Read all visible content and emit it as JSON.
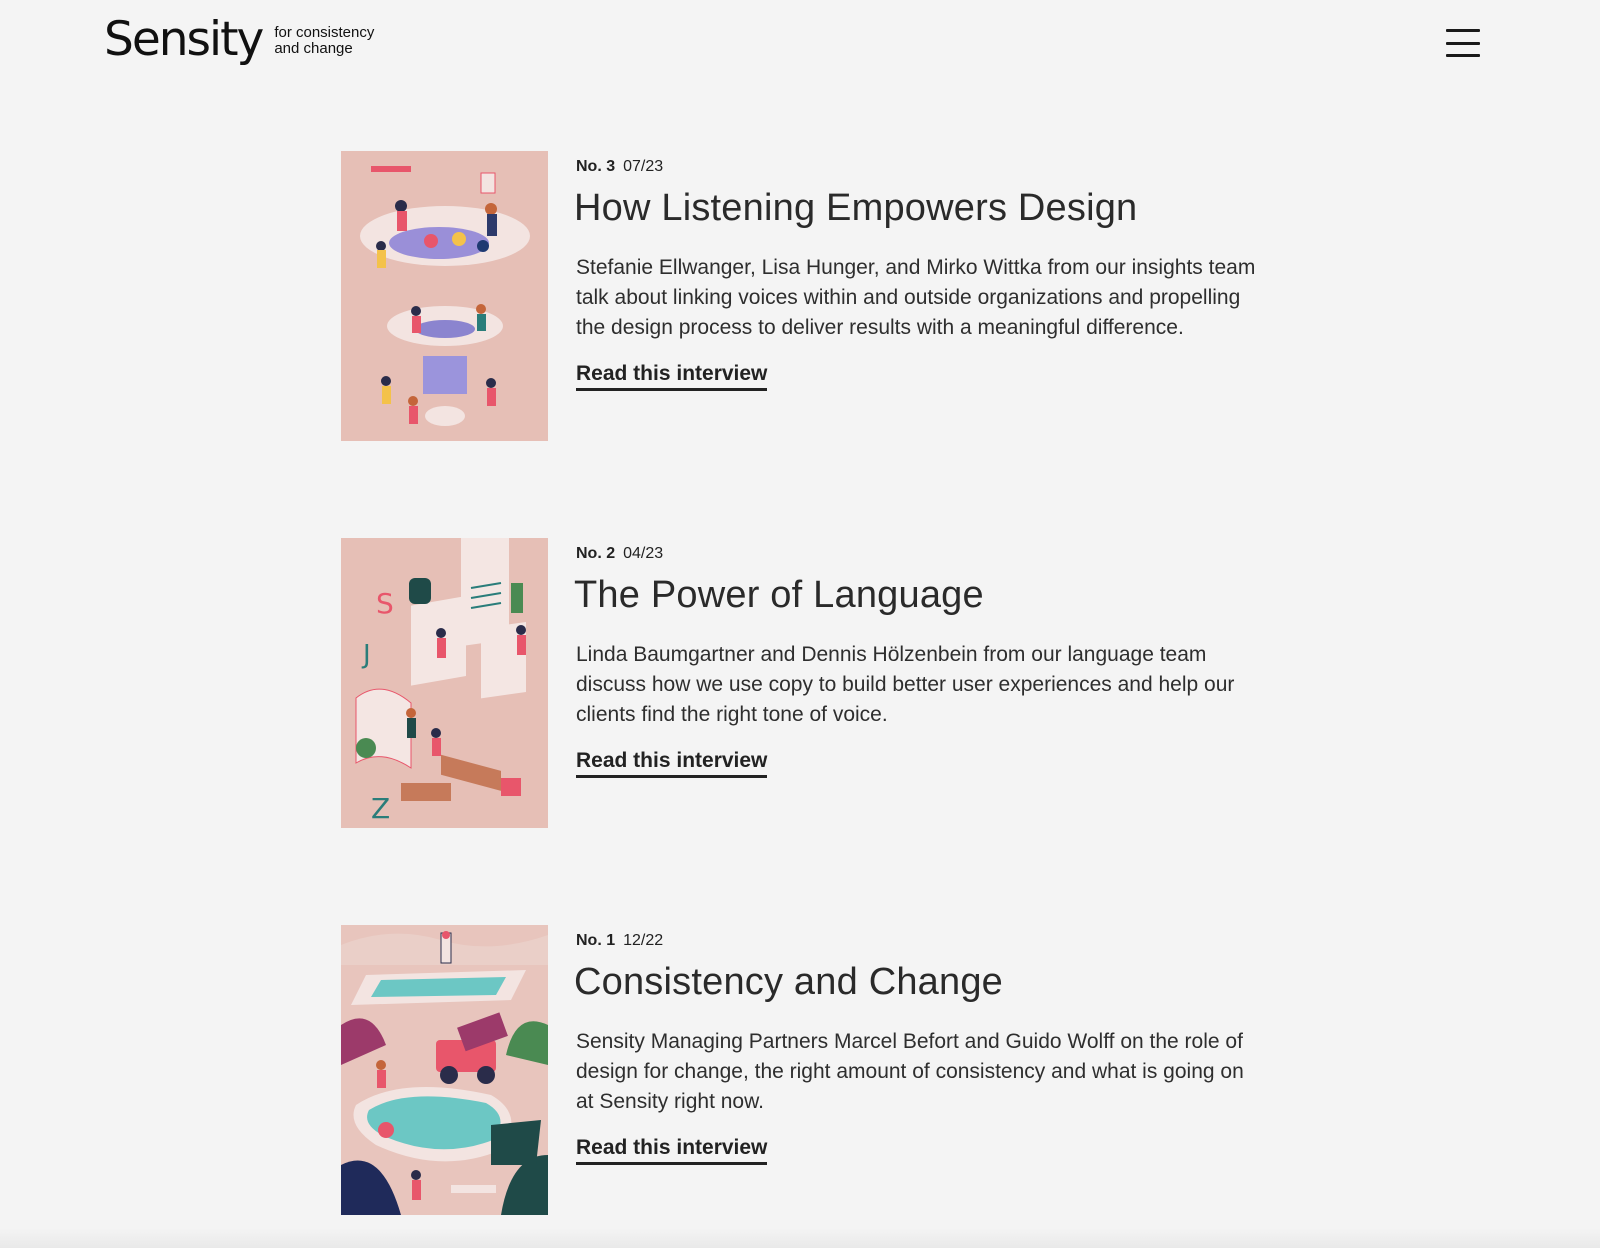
{
  "brand": {
    "name": "Sensity",
    "tagline_line1": "for consistency",
    "tagline_line2": "and change"
  },
  "menu": {
    "icon": "hamburger-menu-icon"
  },
  "articles": [
    {
      "number": "No. 3",
      "date": "07/23",
      "title": "How Listening Empowers Design",
      "description": "Stefanie Ellwanger, Lisa Hunger, and Mirko Wittka from our insights team talk about linking voices within and outside organizations and propelling the design process to deliver results with a meaningful difference.",
      "link": "Read this interview"
    },
    {
      "number": "No. 2",
      "date": "04/23",
      "title": "The Power of Language",
      "description": "Linda Baumgartner and Dennis Hölzenbein from our language team discuss how we use copy to build better user experiences and help our clients find the right tone of voice.",
      "link": "Read this interview"
    },
    {
      "number": "No. 1",
      "date": "12/22",
      "title": "Consistency and Change",
      "description": "Sensity Managing Partners Marcel Befort and Guido Wolff on the role of design for change, the right amount of consistency and what is going on at Sensity right now.",
      "link": "Read this interview"
    }
  ],
  "colors": {
    "background": "#f4f4f4",
    "thumbnail_pink": "#e5bdb4",
    "text": "#222222"
  }
}
